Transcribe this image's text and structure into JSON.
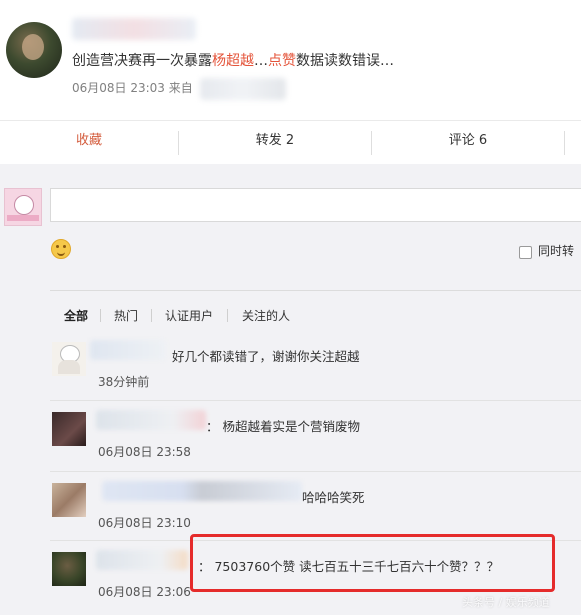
{
  "post": {
    "text_before": "创造营决赛再一次暴露",
    "text_highlight1": "杨超越",
    "text_mid": "…",
    "text_highlight2": "点赞",
    "text_after": "数据读数错误…",
    "meta": "06月08日 23:03 来自"
  },
  "actions": {
    "favorite": "收藏",
    "forward": "转发 2",
    "comment": "评论 6"
  },
  "composer": {
    "forward_also_label": "同时转"
  },
  "filters": [
    "全部",
    "热门",
    "认证用户",
    "关注的人"
  ],
  "comments": [
    {
      "text": "好几个都读错了，谢谢你关注超越",
      "time": "38分钟前"
    },
    {
      "text": "：  杨超越着实是个营销废物",
      "time": "06月08日 23:58"
    },
    {
      "text": "哈哈哈笑死",
      "time": "06月08日 23:10"
    },
    {
      "text": "：  7503760个赞 读七百五十三千七百六十个赞？？？",
      "time": "06月08日 23:06"
    }
  ],
  "watermark": "头条号 / 娱乐频道",
  "colors": {
    "accent": "#e4543a",
    "highlight_box": "#e52b2b"
  }
}
